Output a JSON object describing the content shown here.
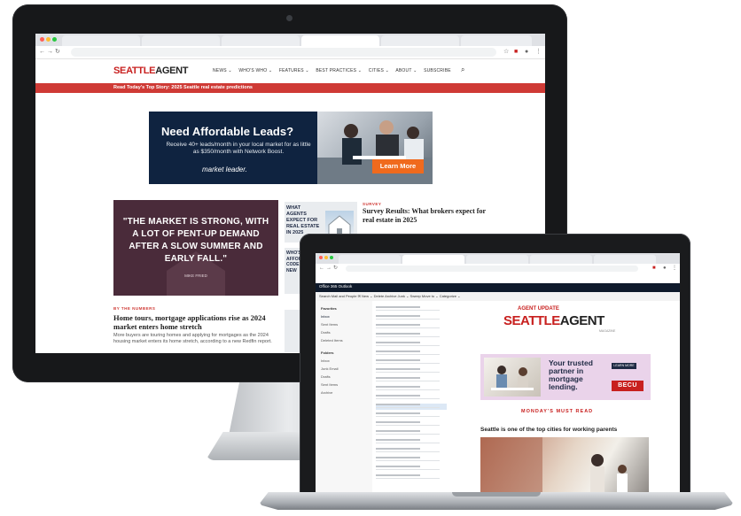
{
  "desktop": {
    "site": {
      "logo_main": "SEATTLE",
      "logo_agent": "AGENT",
      "nav": [
        "NEWS ⌄",
        "WHO'S WHO ⌄",
        "FEATURES ⌄",
        "BEST PRACTICES ⌄",
        "CITIES ⌄",
        "ABOUT ⌄",
        "SUBSCRIBE"
      ],
      "banner": "Read Today's Top Story: 2025 Seattle real estate predictions"
    },
    "ad": {
      "title": "Need Affordable Leads?",
      "body": "Receive 40+ leads/month in your local market for as little as $350/month with Network Boost.",
      "brand": "market leader.",
      "cta": "Learn More"
    },
    "quote": {
      "text": "\"THE MARKET IS STRONG, WITH A LOT OF PENT-UP DEMAND AFTER A SLOW SUMMER AND EARLY FALL.\"",
      "attribution": "MIKE FRIED"
    },
    "survey": {
      "thumb_text": "WHAT AGENTS EXPECT FOR REAL ESTATE IN 2025",
      "category": "SURVEY",
      "title": "Survey Results: What brokers expect for real estate in 2025"
    },
    "thumb2_text": "WHO'S MORE AFFORD ZIP CODE FOR NEW",
    "numbers": {
      "category": "BY THE NUMBERS",
      "title": "Home tours, mortgage applications rise as 2024 market enters home stretch",
      "body": "More buyers are touring homes and applying for mortgages as the 2024 housing market enters its home stretch, according to a new Redfin report."
    }
  },
  "laptop": {
    "appbar": "Office 365     Outlook",
    "toolbar": "Search Mail and People        ✉ New ⌄    Delete    Archive    Junk ⌄    Sweep    Move to ⌄    Categorize ⌄",
    "folders": [
      "Favorites",
      "Inbox",
      "Sent Items",
      "Drafts",
      "Deleted Items",
      "Folders",
      "Inbox",
      "Junk Email",
      "Drafts",
      "Sent Items",
      "Archive"
    ],
    "newsletter": {
      "logo_top": "AGENT UPDATE",
      "logo_main": "SEATTLE",
      "logo_agent": "AGENT",
      "tagline": "MAGAZINE",
      "ad_text": "Your trusted partner in mortgage lending.",
      "ad_button": "LEARN MORE",
      "ad_brand": "BECU",
      "section": "MONDAY'S MUST READ",
      "headline": "Seattle is one of the top cities for working parents"
    }
  },
  "colors": {
    "brand_red": "#c8201f",
    "banner_red": "#cf3a35",
    "ad_navy": "#0f2340",
    "cta_orange": "#f06a1d",
    "quote_plum": "#4a2b3a",
    "outlook_nav": "#0f1a2b",
    "becu_pink": "#ead3ea"
  }
}
